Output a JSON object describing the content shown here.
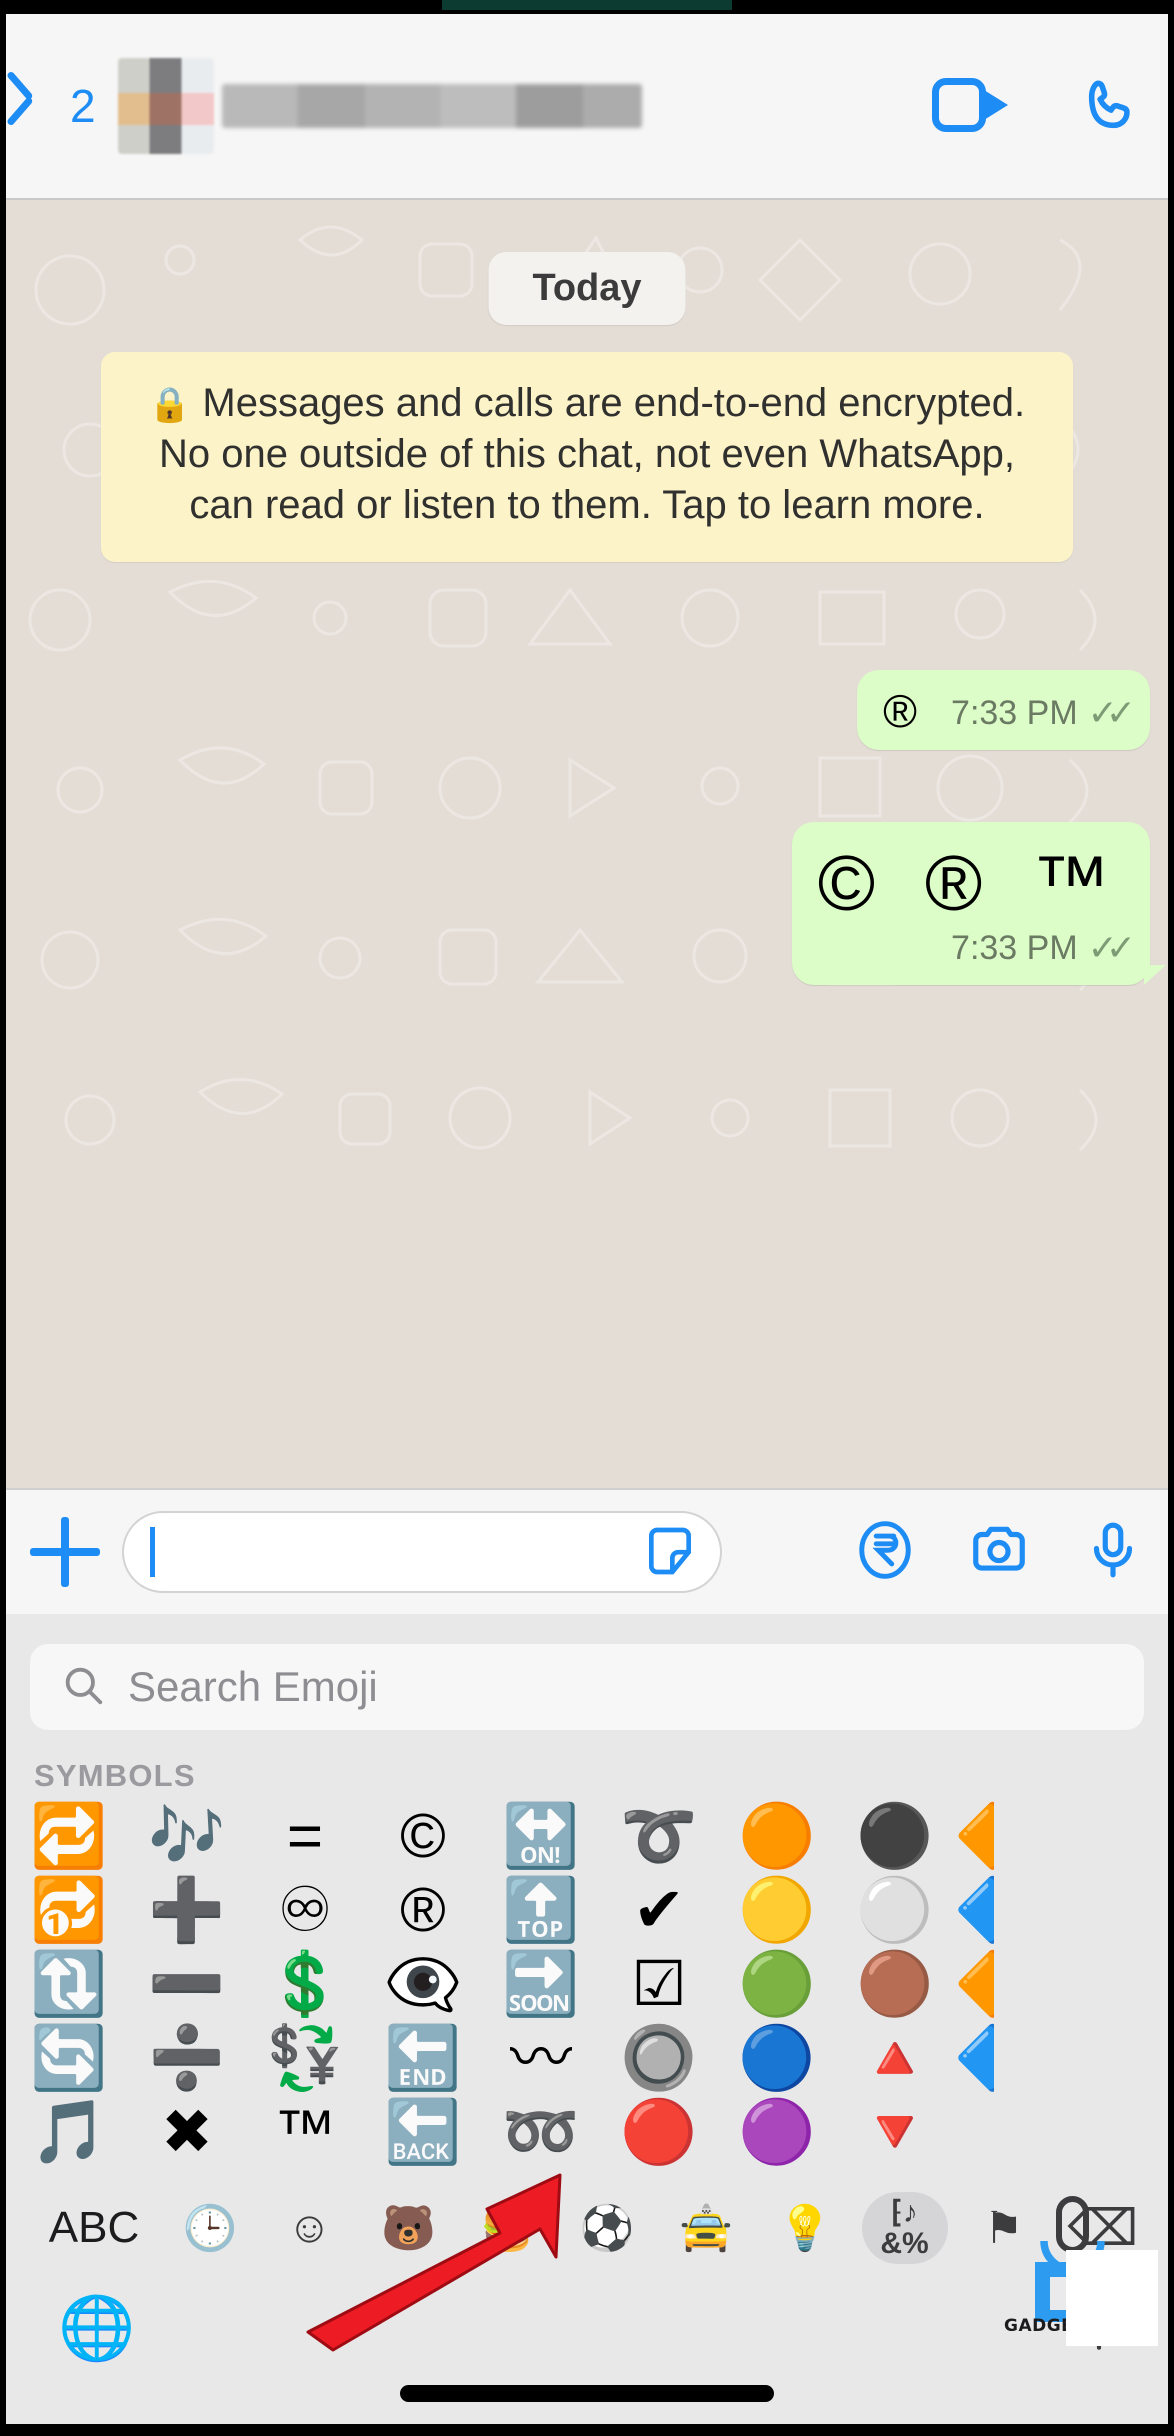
{
  "header": {
    "back_label": "2",
    "back_icon": "chevron-left-icon",
    "contact_name_redacted": "",
    "video_icon": "video-call-icon",
    "voice_icon": "voice-call-icon"
  },
  "chat": {
    "day_divider": "Today",
    "encryption_notice": "Messages and calls are end-to-end encrypted. No one outside of this chat, not even WhatsApp, can read or listen to them. Tap to learn more.",
    "lock_icon": "lock-icon",
    "messages": [
      {
        "text": "®",
        "time": "7:33 PM",
        "status": "read",
        "layout": "inline"
      },
      {
        "text": "© ® ™",
        "time": "7:33 PM",
        "status": "read",
        "layout": "stacked"
      }
    ],
    "tick_glyph": "✓✓"
  },
  "composer": {
    "plus_icon": "plus-icon",
    "input_value": "",
    "input_placeholder": "",
    "sticker_icon": "sticker-icon",
    "payment_icon": "rupee-payment-icon",
    "camera_icon": "camera-icon",
    "mic_icon": "microphone-icon"
  },
  "keyboard": {
    "search_placeholder": "Search Emoji",
    "search_icon": "search-icon",
    "section_title": "SYMBOLS",
    "emoji_rows": [
      [
        "🔁",
        "🎶",
        "=",
        "©",
        "🔛",
        "➰",
        "🟠",
        "⚫",
        "🔶"
      ],
      [
        "🔂",
        "➕",
        "♾",
        "®",
        "🔝",
        "✔",
        "🟡",
        "⚪",
        "🔷"
      ],
      [
        "🔃",
        "➖",
        "💲",
        "👁‍🗨",
        "🔜",
        "☑",
        "🟢",
        "🟤",
        "🔶"
      ],
      [
        "🔄",
        "➗",
        "💱",
        "🔚",
        "〰",
        "🔘",
        "🔵",
        "🔺",
        "🔷"
      ],
      [
        "🎵",
        "✖",
        "™",
        "🔙",
        "➿",
        "🔴",
        "🟣",
        "🔻",
        ""
      ]
    ],
    "categories": [
      {
        "name": "abc-key",
        "label": "ABC",
        "selected": false
      },
      {
        "name": "recents-category",
        "label": "🕒",
        "selected": false
      },
      {
        "name": "smileys-category",
        "label": "☺",
        "selected": false
      },
      {
        "name": "animals-category",
        "label": "🐻",
        "selected": false
      },
      {
        "name": "food-category",
        "label": "🍔",
        "selected": false
      },
      {
        "name": "activities-category",
        "label": "⚽",
        "selected": false
      },
      {
        "name": "travel-category",
        "label": "🚖",
        "selected": false
      },
      {
        "name": "objects-category",
        "label": "💡",
        "selected": false
      },
      {
        "name": "symbols-category",
        "label": "‱♪\n&%",
        "selected": true
      },
      {
        "name": "flags-category",
        "label": "⚑",
        "selected": false
      },
      {
        "name": "backspace-key",
        "label": "⌫",
        "selected": false
      }
    ],
    "globe_icon": "globe-language-icon",
    "dictation_icon": "dictation-microphone-icon"
  },
  "annotation": {
    "arrow_color": "#ED1C24",
    "arrow_target": "symbols-category"
  },
  "watermark": {
    "text": "GADGETS T",
    "accent_color": "#2D9CF0"
  },
  "colors": {
    "accent_blue": "#1d8cf5",
    "bubble_out": "#dcfcc8",
    "chat_bg": "#e4ddd6",
    "notice_bg": "#fdf3c8",
    "keyboard_bg": "#e8e8e9"
  }
}
